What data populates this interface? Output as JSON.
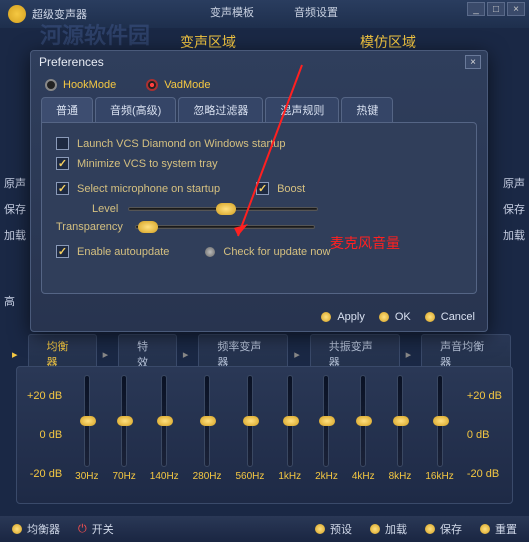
{
  "title": "超级变声器",
  "watermark": "河源软件园",
  "topmenu": {
    "template": "变声模板",
    "audio": "音频设置"
  },
  "regions": {
    "change": "变声区域",
    "sim": "模仿区域"
  },
  "winbtns": {
    "min": "_",
    "max": "□",
    "close": "×"
  },
  "dialog": {
    "title": "Preferences",
    "close": "×",
    "modes": {
      "hook": "HookMode",
      "vad": "VadMode"
    },
    "tabs": {
      "general": "普通",
      "audio_adv": "音频(高级)",
      "ignore": "忽略过滤器",
      "mix": "混声规则",
      "hotkey": "热键"
    },
    "opts": {
      "launch": "Launch VCS Diamond on Windows startup",
      "minimize": "Minimize VCS to system tray",
      "mic": "Select microphone on startup",
      "boost": "Boost",
      "level_lbl": "Level",
      "trans_lbl": "Transparency",
      "auto": "Enable autoupdate",
      "check": "Check for update now"
    },
    "btns": {
      "apply": "Apply",
      "ok": "OK",
      "cancel": "Cancel"
    }
  },
  "annot": {
    "mic_vol": "麦克风音量"
  },
  "side": {
    "orig": "原声",
    "save": "保存",
    "load": "加载",
    "advb": "高"
  },
  "tabs2": {
    "eq": "均衡器",
    "fx": "特效",
    "freq": "频率变声器",
    "res": "共振变声器",
    "voice": "声音均衡器"
  },
  "eq": {
    "scale_top": "+20 dB",
    "scale_mid": "0 dB",
    "scale_bot": "-20 dB",
    "bands": [
      "30Hz",
      "70Hz",
      "140Hz",
      "280Hz",
      "560Hz",
      "1kHz",
      "2kHz",
      "4kHz",
      "8kHz",
      "16kHz"
    ]
  },
  "bottom": {
    "eq": "均衡器",
    "switch": "开关",
    "preset": "预设",
    "load": "加载",
    "save": "保存",
    "reset": "重置"
  }
}
